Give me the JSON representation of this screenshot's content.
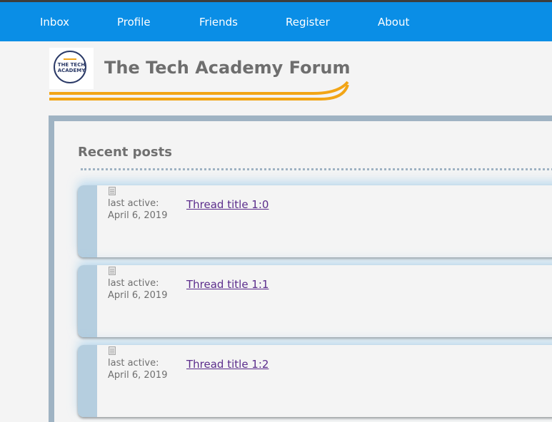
{
  "nav": {
    "items": [
      {
        "label": "Inbox"
      },
      {
        "label": "Profile"
      },
      {
        "label": "Friends"
      },
      {
        "label": "Register"
      },
      {
        "label": "About"
      }
    ]
  },
  "header": {
    "title": "The Tech Academy Forum",
    "logo_text_line1": "THE TECH",
    "logo_text_line2": "ACADEMY"
  },
  "main": {
    "section_title": "Recent posts",
    "posts": [
      {
        "meta_label": "last active:",
        "date": "April 6, 2019",
        "title": "Thread title 1:0"
      },
      {
        "meta_label": "last active:",
        "date": "April 6, 2019",
        "title": "Thread title 1:1"
      },
      {
        "meta_label": "last active:",
        "date": "April 6, 2019",
        "title": "Thread title 1:2"
      }
    ]
  },
  "colors": {
    "nav_bg": "#0a8ee6",
    "accent_swoosh": "#f2a516",
    "link": "#5b2d8c",
    "strip": "#b5cedf"
  },
  "icons": {
    "post_icon": "document-icon"
  }
}
